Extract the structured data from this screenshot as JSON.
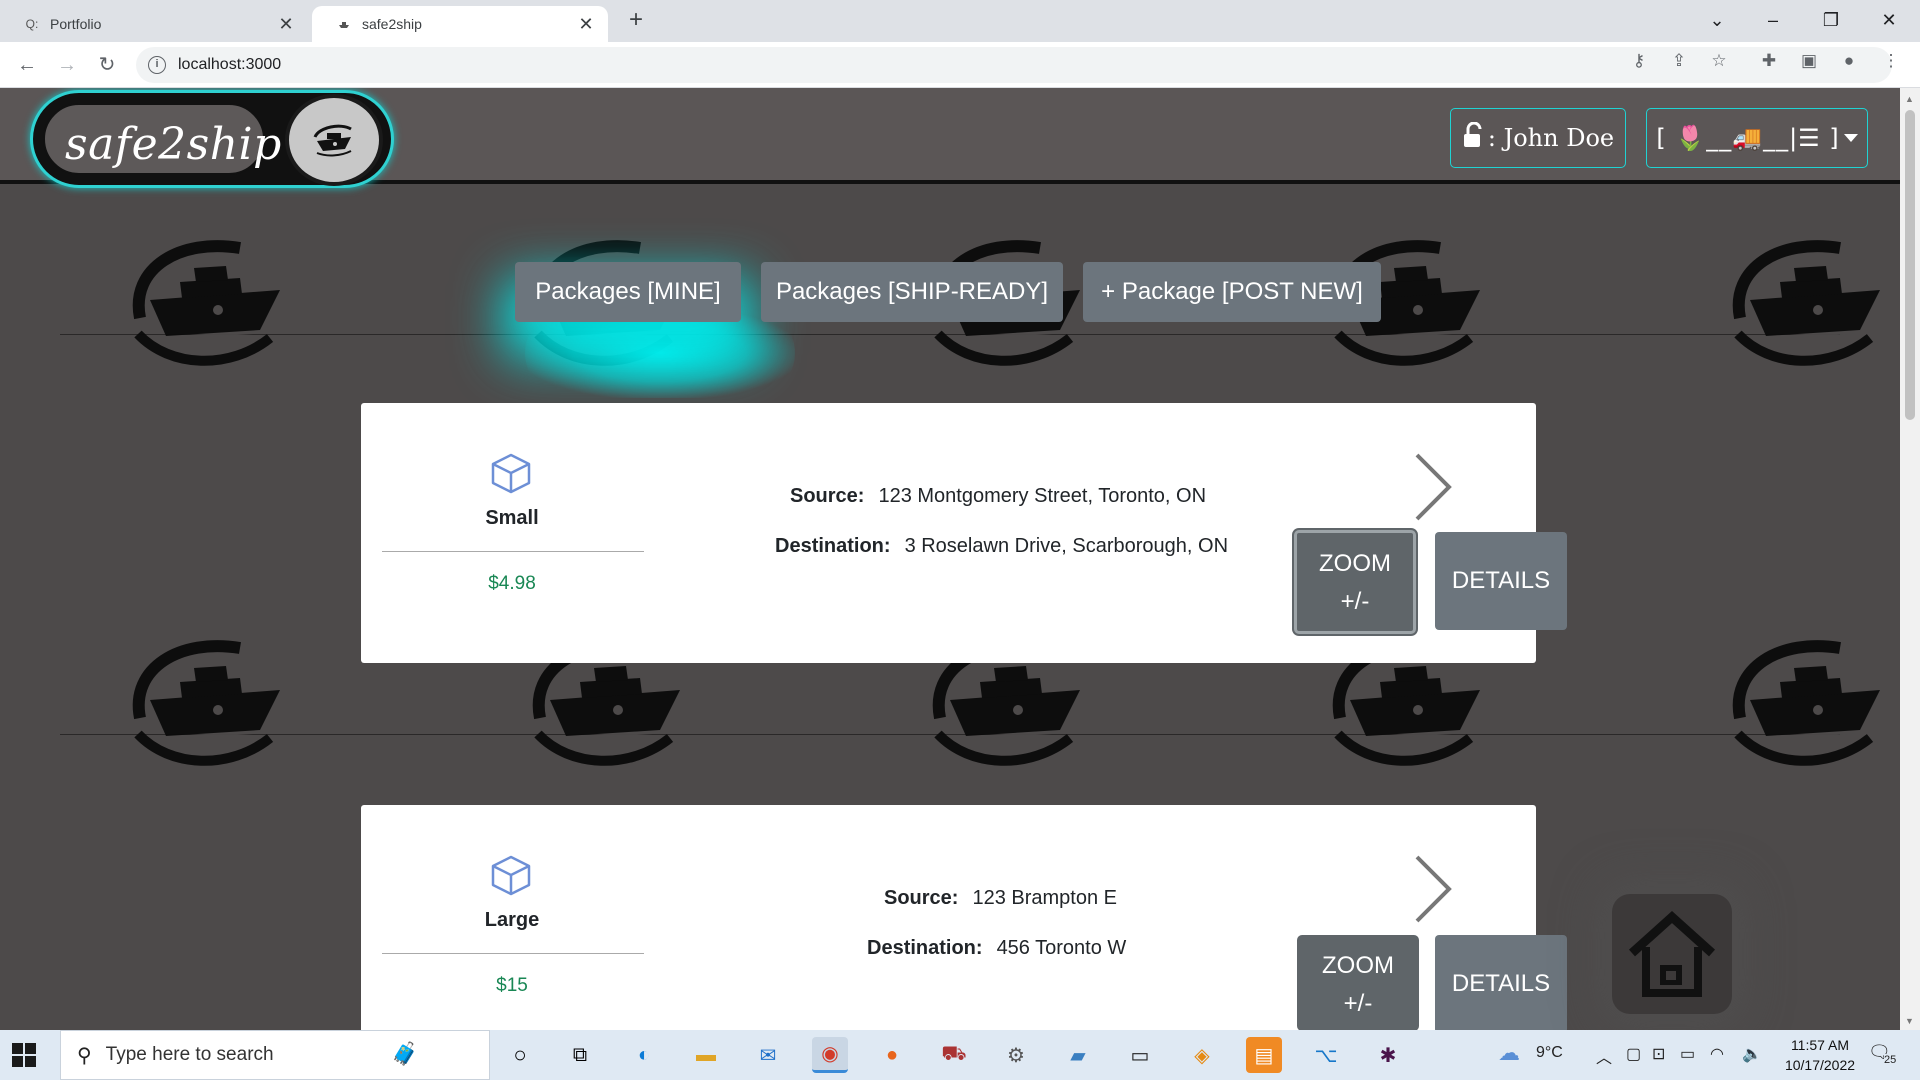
{
  "browser": {
    "tabs": [
      {
        "title": "Portfolio",
        "favicon": "Q:"
      },
      {
        "title": "safe2ship",
        "favicon": "ship"
      }
    ],
    "url": "localhost:3000"
  },
  "header": {
    "brand": "safe2ship",
    "user_label": ": John Doe",
    "menu_label": "[ 🌷__🚚__|☰ ]"
  },
  "nav": {
    "mine": "Packages [MINE]",
    "ship_ready": "Packages [SHIP-READY]",
    "post_new": "+ Package [POST NEW]"
  },
  "packages": [
    {
      "size": "Small",
      "price": "$4.98",
      "source_label": "Source:",
      "source": "123 Montgomery Street, Toronto, ON",
      "destination_label": "Destination:",
      "destination": "3 Roselawn Drive, Scarborough, ON",
      "zoom_label_1": "ZOOM",
      "zoom_label_2": "+/-",
      "details_label": "DETAILS"
    },
    {
      "size": "Large",
      "price": "$15",
      "source_label": "Source:",
      "source": "123 Brampton E",
      "destination_label": "Destination:",
      "destination": "456 Toronto W",
      "zoom_label_1": "ZOOM",
      "zoom_label_2": "+/-",
      "details_label": "DETAILS"
    }
  ],
  "taskbar": {
    "search_placeholder": "Type here to search",
    "weather": "9°C",
    "time": "11:57 AM",
    "date": "10/17/2022",
    "notifications": "25"
  },
  "colors": {
    "accent_cyan": "#1fd3d3",
    "page_bg": "#4d4a4a",
    "button_grey": "#6c757d",
    "price_green": "#198754"
  }
}
